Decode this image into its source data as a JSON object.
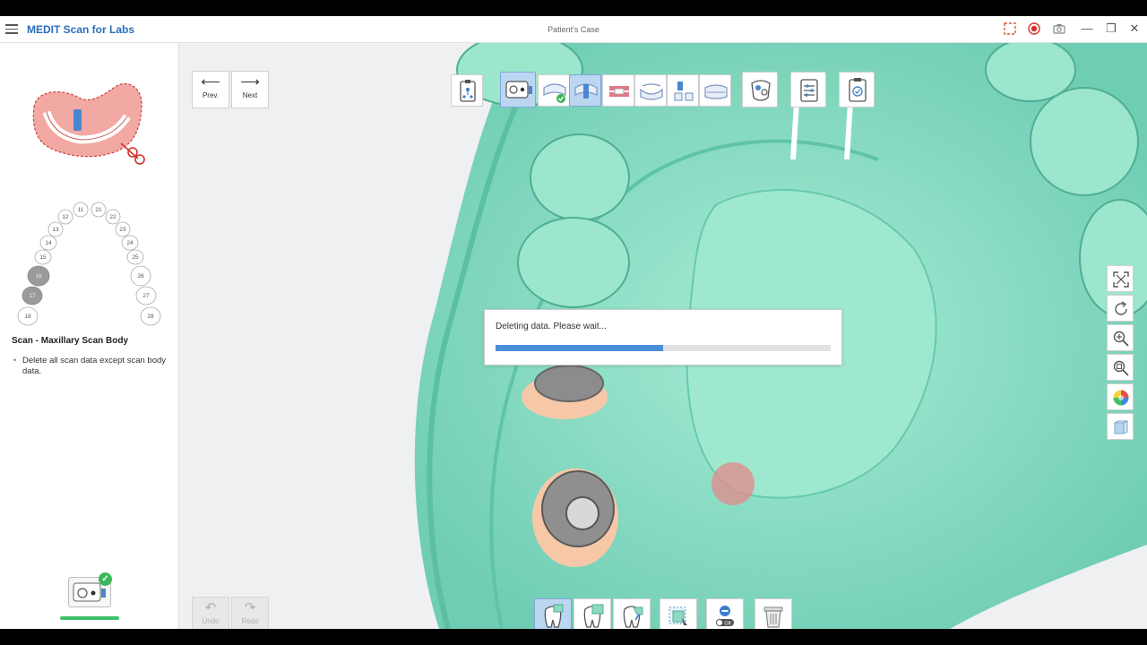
{
  "app": {
    "name": "MEDIT Scan for Labs",
    "window_title": "Patient's Case"
  },
  "window_controls": {
    "icons": [
      "screen-capture-icon",
      "record-icon",
      "camera-icon",
      "minimize-icon",
      "restore-icon",
      "close-icon"
    ],
    "minimize": "—",
    "restore": "❐",
    "close": "✕"
  },
  "navigation": {
    "prev_label": "Prev.",
    "next_label": "Next",
    "undo_label": "Undo",
    "redo_label": "Redo",
    "prev_arrow": "⟵",
    "next_arrow": "⟶",
    "undo_arrow": "↶",
    "redo_arrow": "↷"
  },
  "tooth_chart": {
    "upper_right": [
      "11",
      "12",
      "13",
      "14",
      "15",
      "16",
      "17",
      "18"
    ],
    "upper_left": [
      "21",
      "22",
      "23",
      "24",
      "25",
      "26",
      "27",
      "28"
    ],
    "selected": [
      "16",
      "17"
    ]
  },
  "step": {
    "title": "Scan - Maxillary Scan Body",
    "bullet": "•",
    "description": "Delete all scan data except scan body data."
  },
  "stage_check": "✓",
  "toolbar": {
    "tools": [
      {
        "name": "workflow-tool",
        "active": false
      },
      {
        "name": "scan-body-stage-tool",
        "active": true
      },
      {
        "name": "maxilla-stage-tool",
        "active": false
      },
      {
        "name": "maxilla-scanbody-stage-tool",
        "active": true
      },
      {
        "name": "occlusion-stage-tool",
        "active": false
      },
      {
        "name": "mandible-stage-tool",
        "active": false
      },
      {
        "name": "mandible-scanbody-stage-tool",
        "active": false
      },
      {
        "name": "mandible-model-stage-tool",
        "active": false
      },
      {
        "name": "smart-tips-tool",
        "active": false
      },
      {
        "name": "settings-tool",
        "active": false
      },
      {
        "name": "review-tool",
        "active": false
      }
    ]
  },
  "side_tools": [
    "fit-to-screen-icon",
    "rotate-icon",
    "zoom-icon",
    "zoom-area-icon",
    "color-map-icon",
    "view-cube-icon"
  ],
  "bottom_tools": [
    {
      "name": "select-tooth-tool",
      "active": true
    },
    {
      "name": "lasso-select-tool",
      "active": false
    },
    {
      "name": "brush-select-tool",
      "active": false
    },
    {
      "name": "select-area-tool",
      "active": false
    },
    {
      "name": "lock-toggle-tool",
      "active": false,
      "label": "Off"
    },
    {
      "name": "delete-tool",
      "active": false
    }
  ],
  "dialog": {
    "message": "Deleting data. Please wait...",
    "progress": 0.5
  },
  "colors": {
    "brand": "#2a6ebb",
    "model": "#8fe0c8",
    "progress": "#4b8fd8",
    "active_tool": "#bcd6f2",
    "stage_ok": "#3cc26a"
  }
}
